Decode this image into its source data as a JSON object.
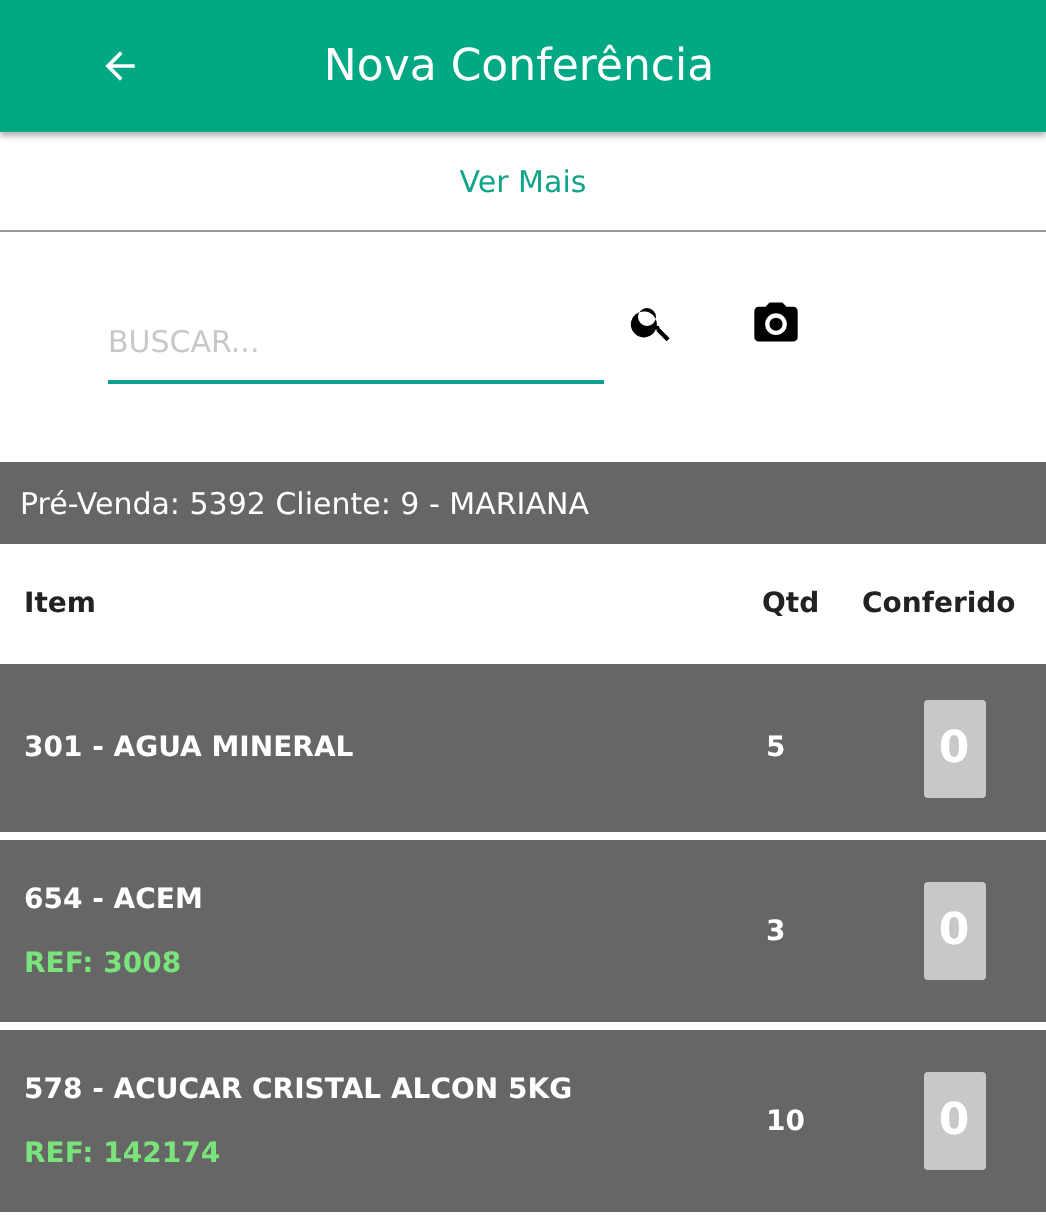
{
  "app_bar": {
    "title": "Nova Conferência"
  },
  "ver_mais": "Ver Mais",
  "search": {
    "placeholder": "BUSCAR..."
  },
  "info_bar": "Pré-Venda: 5392 Cliente: 9 - MARIANA",
  "table": {
    "columns": [
      "Item",
      "Qtd",
      "Conferido"
    ],
    "rows": [
      {
        "item": "301 - AGUA MINERAL",
        "qtd": "5",
        "conferido": "0"
      },
      {
        "item": "654 - ACEM",
        "ref": "REF: 3008",
        "qtd": "3",
        "conferido": "0"
      },
      {
        "item": "578 - ACUCAR CRISTAL ALCON 5KG",
        "ref": "REF: 142174",
        "qtd": "10",
        "conferido": "0"
      }
    ]
  }
}
